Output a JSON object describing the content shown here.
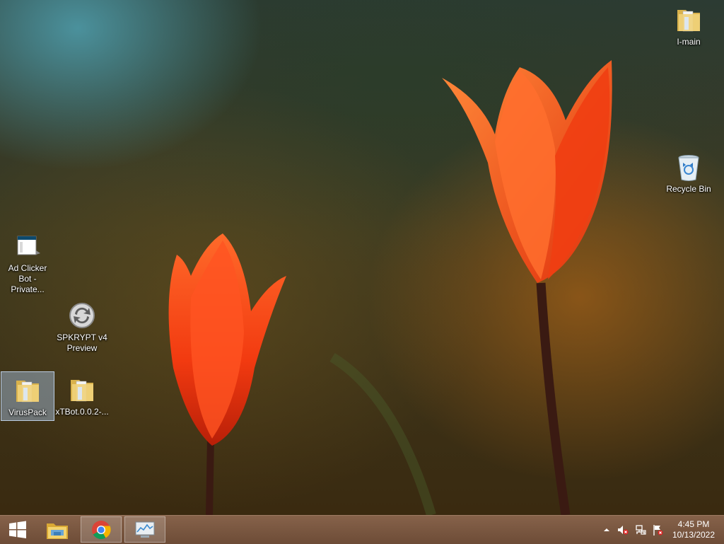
{
  "desktop": {
    "icons": {
      "i_main": {
        "label": "I-main",
        "icon": "folder-icon"
      },
      "recycle_bin": {
        "label": "Recycle Bin",
        "icon": "recycle-bin-icon"
      },
      "ad_clicker": {
        "label": "Ad Clicker Bot - Private...",
        "icon": "application-icon"
      },
      "spkrypt": {
        "label": "SPKRYPT v4 Preview",
        "icon": "circular-arrows-icon"
      },
      "viruspack": {
        "label": "VirusPack",
        "icon": "folder-icon",
        "selected": true
      },
      "xtbot": {
        "label": "xTBot.0.0.2-...",
        "icon": "folder-icon"
      }
    }
  },
  "taskbar": {
    "start": {
      "icon": "windows-start-icon"
    },
    "pinned": [
      {
        "name": "File Explorer",
        "icon": "file-explorer-icon"
      },
      {
        "name": "Google Chrome",
        "icon": "chrome-icon",
        "active": true
      },
      {
        "name": "Task Manager",
        "icon": "task-manager-icon"
      }
    ],
    "tray": {
      "icons": [
        "chevron-up-icon",
        "speaker-muted-icon",
        "network-icon",
        "flag-icon"
      ]
    },
    "clock": {
      "time": "4:45 PM",
      "date": "10/13/2022"
    }
  },
  "colors": {
    "taskbar": "#7a5740",
    "selection": "#aac8eb",
    "folder": "#e8c96a"
  }
}
